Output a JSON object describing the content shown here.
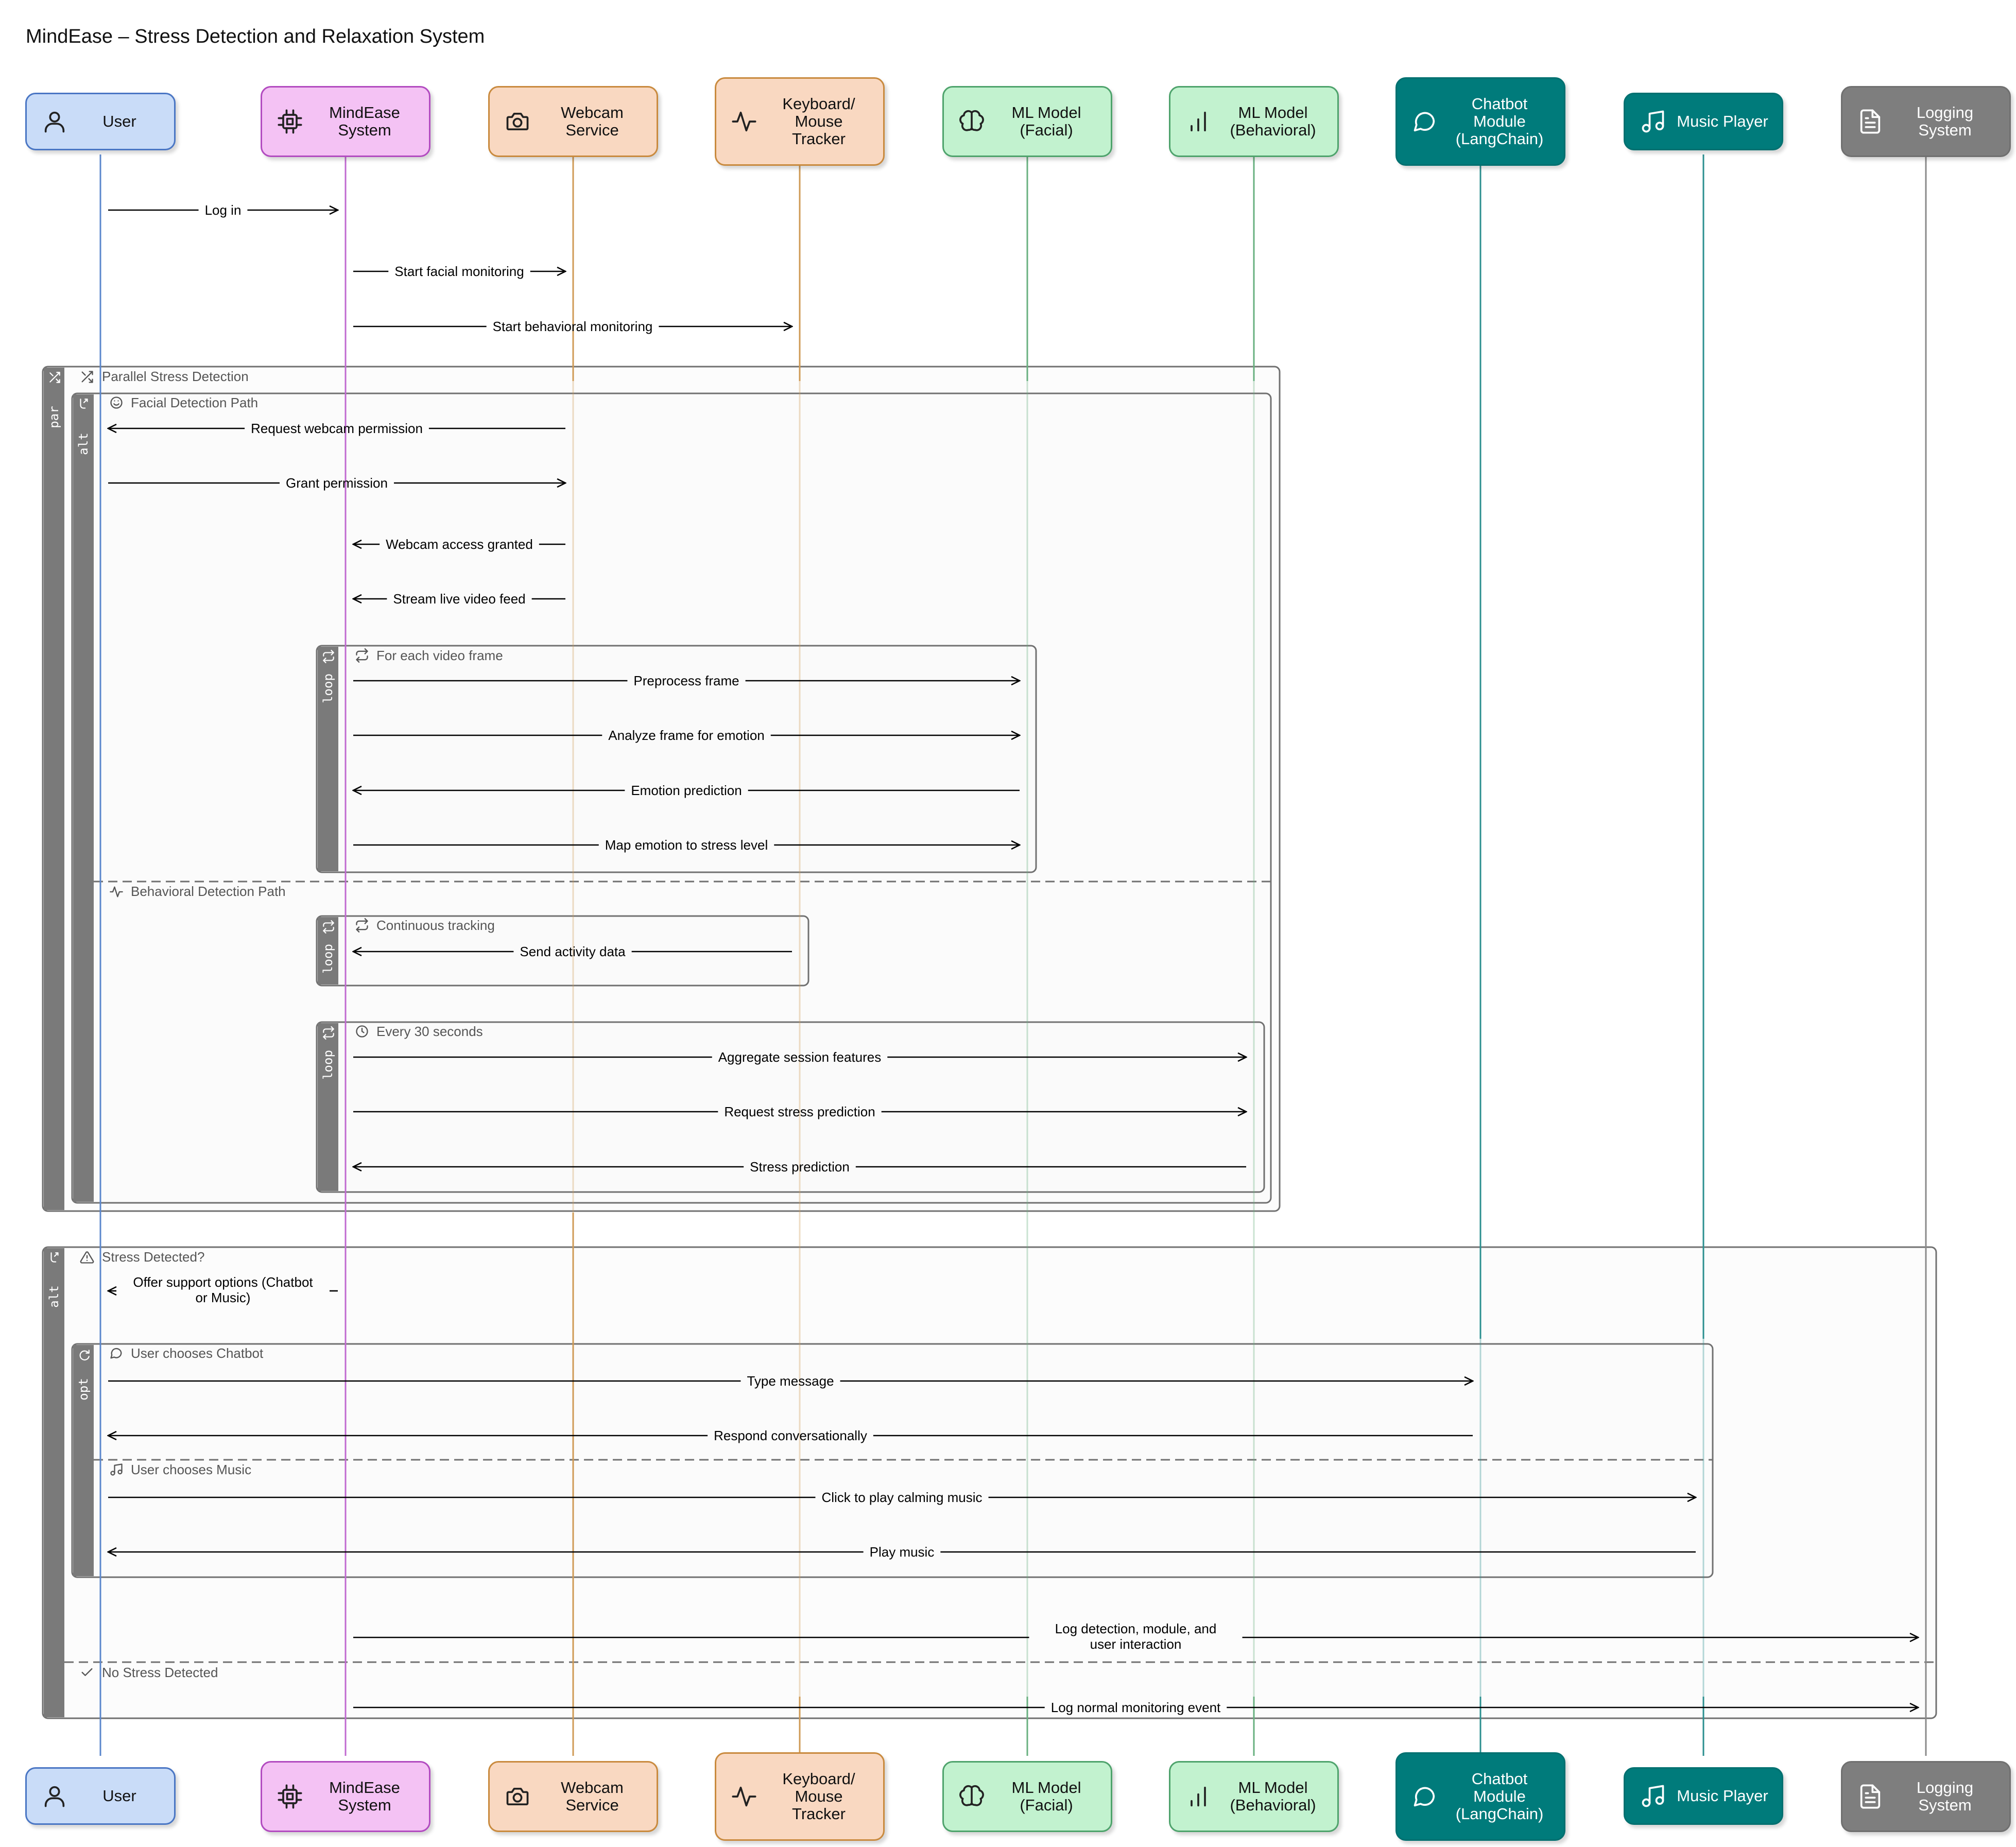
{
  "title": "MindEase – Stress Detection and Relaxation System",
  "colors": {
    "user": {
      "fill": "#c9dcf8",
      "stroke": "#4a76c4",
      "text": "#111111",
      "line": "#5b87cc"
    },
    "system": {
      "fill": "#f4c2f4",
      "stroke": "#b24bc0",
      "text": "#111111",
      "line": "#c06ad0"
    },
    "sensor": {
      "fill": "#f9d8c1",
      "stroke": "#c98a3e",
      "text": "#111111",
      "line": "#cf9a55"
    },
    "ml": {
      "fill": "#c2f2cf",
      "stroke": "#4ea36c",
      "text": "#111111",
      "line": "#68b07f"
    },
    "module": {
      "fill": "#007b7b",
      "stroke": "#007070",
      "text": "#ffffff",
      "line": "#2b8f8f"
    },
    "logging": {
      "fill": "#7e7e7e",
      "stroke": "#707070",
      "text": "#ffffff",
      "line": "#8a8a8a"
    },
    "fragment_border": "#707070",
    "fragment_tab": "#7a7a7a",
    "fragment_fill": "#f9f9f9"
  },
  "participants": [
    {
      "id": "user",
      "label": "User",
      "icon": "user-icon",
      "style": "user"
    },
    {
      "id": "system",
      "label": "MindEase\nSystem",
      "icon": "cpu-icon",
      "style": "system"
    },
    {
      "id": "webcam",
      "label": "Webcam\nService",
      "icon": "camera-icon",
      "style": "sensor"
    },
    {
      "id": "tracker",
      "label": "Keyboard/\nMouse\nTracker",
      "icon": "activity-icon",
      "style": "sensor"
    },
    {
      "id": "mlf",
      "label": "ML Model\n(Facial)",
      "icon": "brain-icon",
      "style": "ml"
    },
    {
      "id": "mlb",
      "label": "ML Model\n(Behavioral)",
      "icon": "bar-chart-icon",
      "style": "ml"
    },
    {
      "id": "chatbot",
      "label": "Chatbot\nModule\n(LangChain)",
      "icon": "chat-icon",
      "style": "module"
    },
    {
      "id": "music",
      "label": "Music Player",
      "icon": "music-icon",
      "style": "module"
    },
    {
      "id": "logging",
      "label": "Logging\nSystem",
      "icon": "file-text-icon",
      "style": "logging"
    }
  ],
  "messages": [
    {
      "from": "user",
      "to": "system",
      "label": "Log in"
    },
    {
      "from": "system",
      "to": "webcam",
      "label": "Start facial monitoring"
    },
    {
      "from": "system",
      "to": "tracker",
      "label": "Start behavioral monitoring"
    },
    {
      "from": "webcam",
      "to": "user",
      "label": "Request webcam permission"
    },
    {
      "from": "user",
      "to": "webcam",
      "label": "Grant permission"
    },
    {
      "from": "webcam",
      "to": "system",
      "label": "Webcam access granted"
    },
    {
      "from": "webcam",
      "to": "system",
      "label": "Stream live video feed"
    },
    {
      "from": "system",
      "to": "mlf",
      "label": "Preprocess frame"
    },
    {
      "from": "system",
      "to": "mlf",
      "label": "Analyze frame for emotion"
    },
    {
      "from": "mlf",
      "to": "system",
      "label": "Emotion prediction"
    },
    {
      "from": "system",
      "to": "mlf",
      "label": "Map emotion to stress level"
    },
    {
      "from": "tracker",
      "to": "system",
      "label": "Send activity data"
    },
    {
      "from": "system",
      "to": "mlb",
      "label": "Aggregate session features"
    },
    {
      "from": "system",
      "to": "mlb",
      "label": "Request stress prediction"
    },
    {
      "from": "mlb",
      "to": "system",
      "label": "Stress prediction"
    },
    {
      "from": "system",
      "to": "user",
      "label": "Offer support options (Chatbot\nor Music)"
    },
    {
      "from": "user",
      "to": "chatbot",
      "label": "Type message"
    },
    {
      "from": "chatbot",
      "to": "user",
      "label": "Respond conversationally"
    },
    {
      "from": "user",
      "to": "music",
      "label": "Click to play calming music"
    },
    {
      "from": "music",
      "to": "user",
      "label": "Play music"
    },
    {
      "from": "system",
      "to": "logging",
      "label": "Log detection, module, and\nuser interaction"
    },
    {
      "from": "system",
      "to": "logging",
      "label": "Log normal monitoring event"
    }
  ],
  "fragments": [
    {
      "keyword": "par",
      "icon": "shuffle-icon",
      "title": "Parallel Stress Detection"
    },
    {
      "keyword": "alt",
      "icon": "branch-icon",
      "title": "Facial Detection Path",
      "title_icon": "smile-icon",
      "else_title": "Behavioral Detection Path",
      "else_icon": "activity-icon"
    },
    {
      "keyword": "loop",
      "icon": "repeat-icon",
      "title": "For each video frame",
      "title_icon": "repeat-icon"
    },
    {
      "keyword": "loop",
      "icon": "repeat-icon",
      "title": "Continuous tracking",
      "title_icon": "repeat-icon"
    },
    {
      "keyword": "loop",
      "icon": "repeat-icon",
      "title": "Every 30 seconds",
      "title_icon": "clock-icon"
    },
    {
      "keyword": "alt",
      "icon": "branch-icon",
      "title": "Stress Detected?",
      "title_icon": "warning-icon",
      "else_title": "No Stress Detected",
      "else_icon": "check-icon"
    },
    {
      "keyword": "opt",
      "icon": "redo-icon",
      "title": "User chooses Chatbot",
      "title_icon": "chat-icon",
      "else_title": "User chooses Music",
      "else_icon": "music-icon"
    }
  ]
}
